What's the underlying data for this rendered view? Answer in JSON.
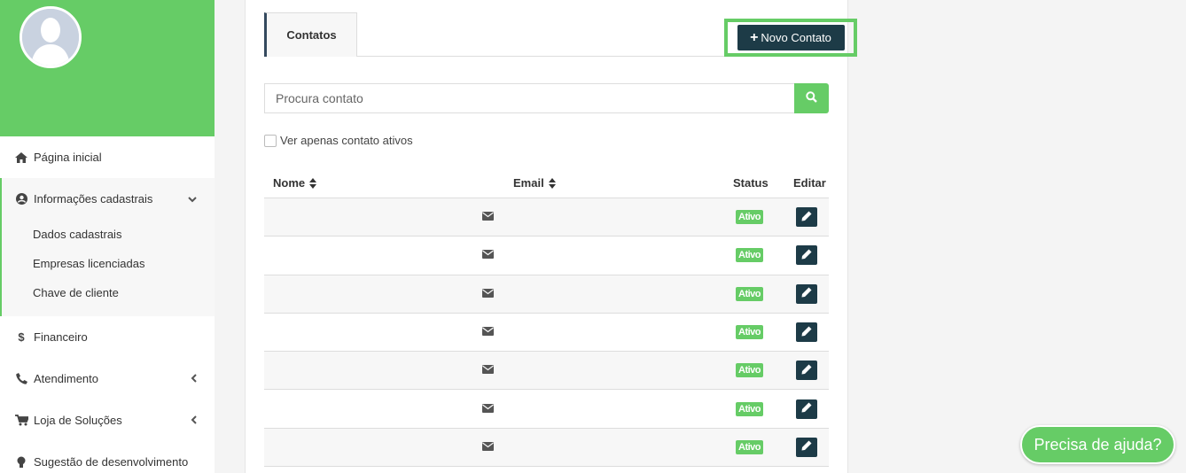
{
  "sidebar": {
    "accent": "#66cc66",
    "items": {
      "home": {
        "label": "Página inicial",
        "icon": "home-icon"
      },
      "info": {
        "label": "Informações cadastrais",
        "icon": "user-circle-icon"
      },
      "financeiro": {
        "label": "Financeiro",
        "icon": "dollar-icon"
      },
      "atendimento": {
        "label": "Atendimento",
        "icon": "phone-icon"
      },
      "loja": {
        "label": "Loja de Soluções",
        "icon": "cart-icon"
      },
      "sugestao": {
        "label": "Sugestão de desenvolvimento",
        "icon": "lightbulb-icon"
      }
    },
    "subitems": [
      "Dados cadastrais",
      "Empresas licenciadas",
      "Chave de cliente"
    ]
  },
  "tabs": {
    "contatos": "Contatos"
  },
  "toolbar": {
    "new_contact_label": "Novo Contato"
  },
  "search": {
    "placeholder": "Procura contato"
  },
  "filter": {
    "label": "Ver apenas contato ativos"
  },
  "table": {
    "headers": {
      "nome": "Nome",
      "email": "Email",
      "status": "Status",
      "editar": "Editar"
    },
    "rows": [
      {
        "status": "Ativo"
      },
      {
        "status": "Ativo"
      },
      {
        "status": "Ativo"
      },
      {
        "status": "Ativo"
      },
      {
        "status": "Ativo"
      },
      {
        "status": "Ativo"
      },
      {
        "status": "Ativo"
      }
    ]
  },
  "help": {
    "label": "Precisa de ajuda?"
  },
  "colors": {
    "green": "#66cc66",
    "dark": "#1d3b47"
  }
}
